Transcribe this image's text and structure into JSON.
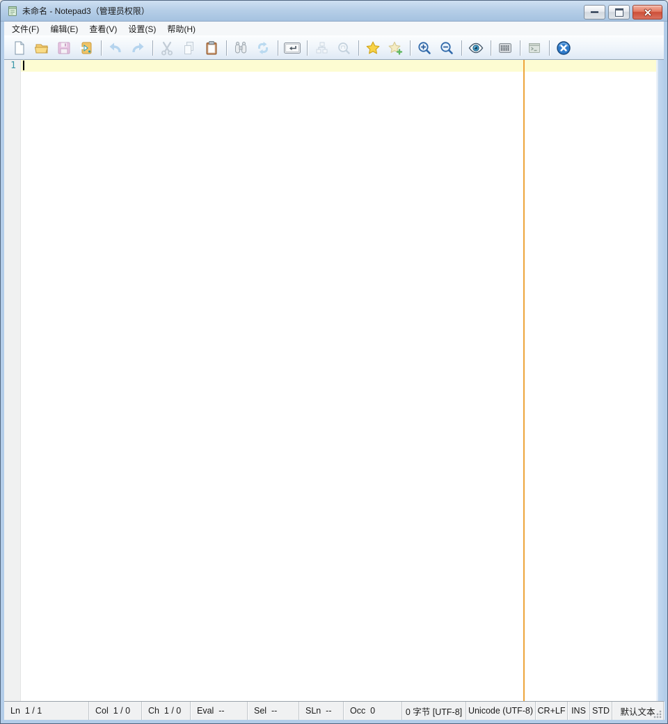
{
  "window": {
    "title": "未命名 - Notepad3（管理员权限）",
    "app_icon": "notepad-icon"
  },
  "menu": {
    "items": [
      "文件(F)",
      "编辑(E)",
      "查看(V)",
      "设置(S)",
      "帮助(H)"
    ]
  },
  "toolbar": {
    "buttons": [
      {
        "icon": "new-file-icon",
        "enabled": true
      },
      {
        "icon": "open-folder-icon",
        "enabled": true
      },
      {
        "icon": "save-icon",
        "enabled": false
      },
      {
        "icon": "browse-files-icon",
        "enabled": true
      },
      {
        "icon": "undo-icon",
        "enabled": false
      },
      {
        "icon": "redo-icon",
        "enabled": false
      },
      {
        "icon": "cut-icon",
        "enabled": false
      },
      {
        "icon": "copy-icon",
        "enabled": false
      },
      {
        "icon": "paste-icon",
        "enabled": true
      },
      {
        "icon": "find-icon",
        "enabled": true
      },
      {
        "icon": "replace-icon",
        "enabled": true
      },
      {
        "icon": "word-wrap-icon",
        "enabled": true
      },
      {
        "icon": "folding-icon",
        "enabled": false
      },
      {
        "icon": "zoom-selection-icon",
        "enabled": false
      },
      {
        "icon": "favorites-star-icon",
        "enabled": true
      },
      {
        "icon": "add-favorite-icon",
        "enabled": true
      },
      {
        "icon": "zoom-in-icon",
        "enabled": true
      },
      {
        "icon": "zoom-out-icon",
        "enabled": true
      },
      {
        "icon": "view-eye-icon",
        "enabled": true
      },
      {
        "icon": "scheme-settings-icon",
        "enabled": true
      },
      {
        "icon": "console-icon",
        "enabled": false
      },
      {
        "icon": "exit-icon",
        "enabled": true
      }
    ]
  },
  "editor": {
    "line_numbers": [
      "1"
    ],
    "content": "",
    "caret": {
      "line": 1,
      "col": 1
    }
  },
  "statusbar": {
    "cells": [
      "Ln  1 / 1",
      "Col  1 / 0",
      "Ch  1 / 0",
      "Eval  --",
      "Sel  --",
      "SLn  --",
      "Occ  0",
      "0 字节 [UTF-8]",
      "Unicode (UTF-8)",
      "CR+LF",
      "INS",
      "STD",
      "默认文本"
    ]
  },
  "colors": {
    "titlebar": "#b7cfe8",
    "frame": "#b3cde9",
    "toolbar_bg": "#eef4fa",
    "current_line_bg": "#fdfcd2",
    "long_line_marker": "#eda43b",
    "line_number_fg": "#3a96a8",
    "status_bg": "#f0f1f2",
    "close_button": "#cc4f38",
    "favorite_star": "#f8d348",
    "accent_blue": "#2f7bca"
  }
}
